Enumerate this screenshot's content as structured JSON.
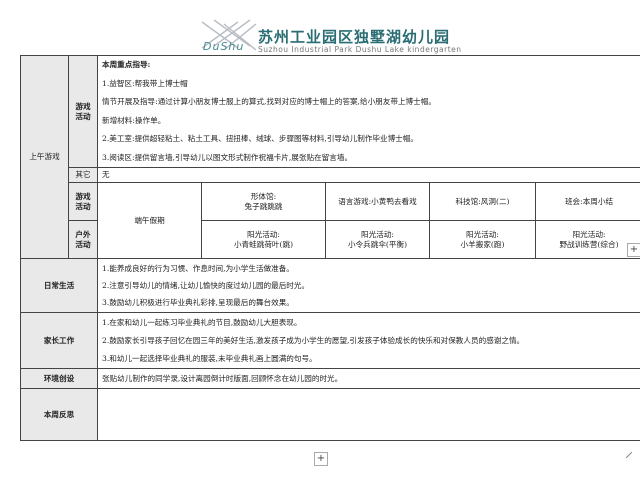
{
  "logo": {
    "dushu_text": "DuShu",
    "school_name": "苏州工业园区独墅湖幼儿园",
    "english_name": "Suzhou Industrial Park Dushu Lake kindergarten"
  },
  "table": {
    "morning_label": "上午游戏",
    "game_activity_label": "游戏活动",
    "game_activity": {
      "heading": "本周重点指导:",
      "lines": [
        "1.益智区:帮我带上博士帽",
        "情节开展及指导:通过计算小朋友博士服上的算式,找到对应的博士帽上的答案,给小朋友带上博士帽。",
        "新增材料:操作单。",
        "2.美工室:提供超轻粘土、粘土工具、扭扭棒、绒球、步骤图等材料,引导幼儿制作毕业博士帽。",
        "3.阅读区:提供留言墙,引导幼儿以图文形式制作祝福卡片,展张贴在留言墙。"
      ]
    },
    "other_label": "其它",
    "other_value": "无",
    "game_row_label": "游戏活动",
    "dragon_boat": "端午假期",
    "games": [
      [
        "形体馆:",
        "兔子跳跳跳"
      ],
      [
        "语言游戏:小黄鸭去看戏"
      ],
      [
        "科技馆:风洞(二)"
      ],
      [
        "班会:本周小结"
      ]
    ],
    "outdoor_label": "户外活动",
    "outdoor": [
      [
        "阳光活动:",
        "小青蛙跳荷叶(跳)"
      ],
      [
        "阳光活动:",
        "小令兵跳伞(平衡)"
      ],
      [
        "阳光活动:",
        "小羊搬家(跑)"
      ],
      [
        "阳光活动:",
        "野战训练营(综合)"
      ]
    ],
    "daily_life_label": "日常生活",
    "daily_life": [
      "1.能养成良好的行为习惯、作息时间,为小学生活做准备。",
      "2.注意引导幼儿的情绪,让幼儿愉快的度过幼儿园的最后时光。",
      "3.鼓励幼儿积极进行毕业典礼彩排,呈现最后的舞台效果。"
    ],
    "parents_label": "家长工作",
    "parents": [
      "1.在家和幼儿一起练习毕业典礼的节目,鼓励幼儿大胆表现。",
      "2.鼓励家长引导孩子回忆在园三年的美好生活,激发孩子成为小学生的愿望,引发孩子体验成长的快乐和对保教人员的感谢之情。",
      "3.和幼儿一起选择毕业典礼的服装,未毕业典礼画上圆满的句号。"
    ],
    "environment_label": "环境创设",
    "environment": "张贴幼儿制作的同学录,设计离园倒计时版面,回顾怀念在幼儿园的时光。",
    "reflection_label": "本周反思",
    "reflection": ""
  },
  "controls": {
    "add_row_symbol": "+",
    "add_col_symbol": "+"
  }
}
